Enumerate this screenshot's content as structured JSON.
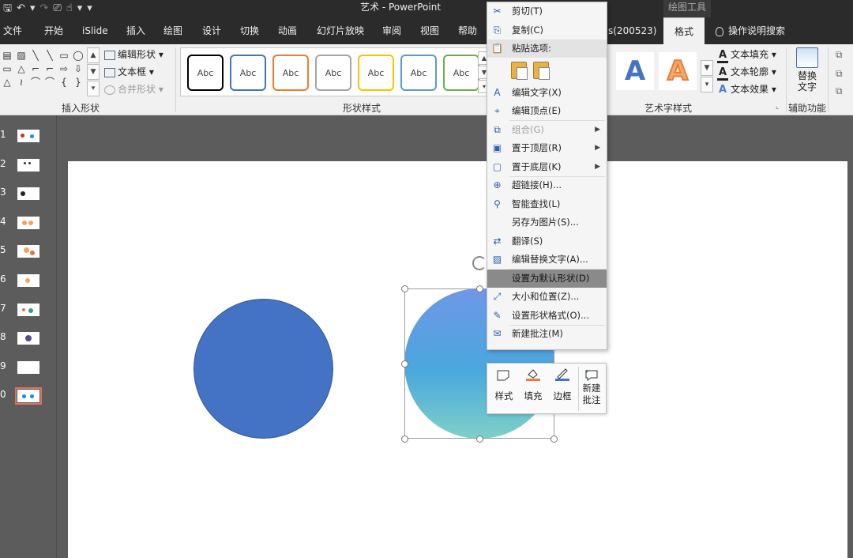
{
  "window": {
    "title": "艺术  -  PowerPoint",
    "drawing_tools_label": "绘图工具",
    "qat": {
      "save": "🖫",
      "undo": "↶",
      "redo": "↷",
      "present": "⎚",
      "touch": "☝",
      "more": "▾"
    }
  },
  "tabs": [
    {
      "label": "文件"
    },
    {
      "label": "开始"
    },
    {
      "label": "iSlide"
    },
    {
      "label": "插入"
    },
    {
      "label": "绘图"
    },
    {
      "label": "设计"
    },
    {
      "label": "切换"
    },
    {
      "label": "动画"
    },
    {
      "label": "幻灯片放映"
    },
    {
      "label": "审阅"
    },
    {
      "label": "视图"
    },
    {
      "label": "帮助"
    },
    {
      "label": "s(200523)"
    },
    {
      "label": "格式"
    }
  ],
  "tell_me": "操作说明搜索",
  "ribbon": {
    "insert_shapes": {
      "label": "插入形状",
      "edit_shape": "编辑形状",
      "text_box": "文本框",
      "merge_shapes": "合并形状",
      "shapes": [
        "▤",
        "▨",
        "╲",
        "╲",
        "▭",
        "◯",
        "▭",
        "△",
        "⌐",
        "⌐",
        "⇨",
        "⇩",
        "△",
        "≀",
        "⌒",
        "⌒",
        "{",
        "}"
      ]
    },
    "shape_styles": {
      "label": "形状样式",
      "swatch_text": "Abc",
      "swatch_colors": [
        "#000000",
        "#4472c4",
        "#ed7d31",
        "#a5a5a5",
        "#ffc000",
        "#5b9bd5",
        "#70ad47"
      ]
    },
    "wordart_styles": {
      "label": "艺术字样式",
      "sample": "A",
      "text_fill": "文本填充",
      "text_outline": "文本轮廓",
      "text_effects": "文本效果"
    },
    "accessibility": {
      "label": "辅助功能",
      "alt_text_line1": "替换",
      "alt_text_line2": "文字"
    }
  },
  "thumbnails": [
    {
      "num": "1"
    },
    {
      "num": "2"
    },
    {
      "num": "3"
    },
    {
      "num": "4"
    },
    {
      "num": "5"
    },
    {
      "num": "6"
    },
    {
      "num": "7"
    },
    {
      "num": "8"
    },
    {
      "num": "9"
    },
    {
      "num": "0",
      "selected": true
    }
  ],
  "slide": {
    "solid_circle_color": "#4472c4",
    "gradient_colors": [
      "#6f97e8",
      "#4aa8dd",
      "#7fd0c8"
    ]
  },
  "context_menu": {
    "items": [
      {
        "label": "剪切(T)",
        "icon": "scissors-icon"
      },
      {
        "label": "复制(C)",
        "icon": "copy-icon"
      },
      {
        "label": "粘贴选项:",
        "icon": "paste-icon",
        "header": true
      },
      {
        "label": "编辑文字(X)",
        "icon": "edit-text-icon"
      },
      {
        "label": "编辑顶点(E)",
        "icon": "edit-points-icon"
      },
      {
        "label": "组合(G)",
        "icon": "group-icon",
        "disabled": true,
        "submenu": true
      },
      {
        "label": "置于顶层(R)",
        "icon": "bring-front-icon",
        "submenu": true
      },
      {
        "label": "置于底层(K)",
        "icon": "send-back-icon",
        "submenu": true
      },
      {
        "label": "超链接(H)...",
        "icon": "link-icon"
      },
      {
        "label": "智能查找(L)",
        "icon": "smart-lookup-icon"
      },
      {
        "label": "另存为图片(S)...",
        "icon": ""
      },
      {
        "label": "翻译(S)",
        "icon": "translate-icon"
      },
      {
        "label": "编辑替换文字(A)...",
        "icon": "alt-text-icon"
      },
      {
        "label": "设置为默认形状(D)",
        "icon": "",
        "highlight": true
      },
      {
        "label": "大小和位置(Z)...",
        "icon": "size-position-icon"
      },
      {
        "label": "设置形状格式(O)...",
        "icon": "format-shape-icon"
      },
      {
        "label": "新建批注(M)",
        "icon": "new-comment-icon"
      }
    ]
  },
  "mini_toolbar": {
    "style": "样式",
    "fill": "填充",
    "outline": "边框",
    "new_comment_line1": "新建",
    "new_comment_line2": "批注",
    "fill_color": "#ed7d31",
    "outline_color": "#4472c4"
  }
}
